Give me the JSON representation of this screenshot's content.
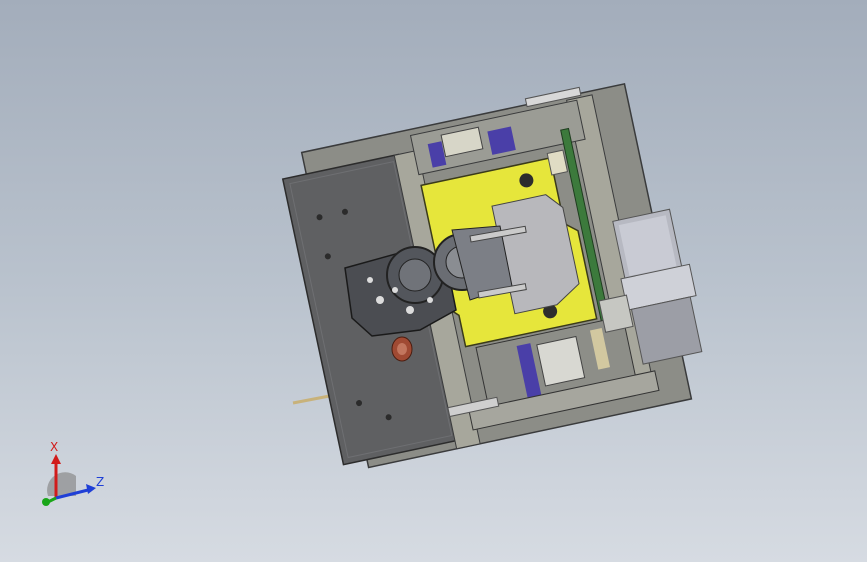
{
  "viewport": {
    "background_top": "#a3adbb",
    "background_bottom": "#d6dbe2"
  },
  "model": {
    "plate_color": "#5f6062",
    "frame_color": "#8c8d87",
    "highlight_color": "#e6e63b",
    "accent_color": "#4a3fa8",
    "motor_color": "#b7b9c2",
    "rail_color": "#3c7a3c"
  },
  "triad": {
    "x_label": "X",
    "z_label": "Z",
    "x_color": "#d11b1b",
    "y_color": "#19a619",
    "z_color": "#1f3fd6"
  }
}
